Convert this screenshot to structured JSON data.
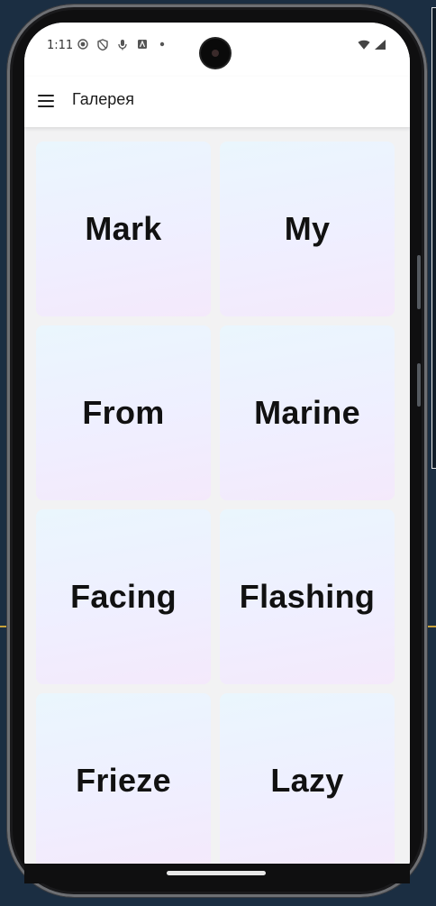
{
  "status_bar": {
    "time": "1:11",
    "left_icons": [
      "record-icon",
      "shield-icon",
      "mic-icon",
      "font-icon",
      "dot-icon"
    ],
    "right_icons": [
      "wifi-icon",
      "cell-signal-icon"
    ]
  },
  "app_bar": {
    "title": "Галерея",
    "menu_icon": "hamburger-menu-icon"
  },
  "gallery": {
    "items": [
      {
        "label": "Mark"
      },
      {
        "label": "My"
      },
      {
        "label": "From"
      },
      {
        "label": "Marine"
      },
      {
        "label": "Facing"
      },
      {
        "label": "Flashing"
      },
      {
        "label": "Frieze"
      },
      {
        "label": "Lazy"
      }
    ]
  },
  "colors": {
    "card_gradient_top": "#eaf6fd",
    "card_gradient_bottom": "#f4e9fb",
    "background": "#f2f2f3",
    "app_bar": "#ffffff"
  }
}
